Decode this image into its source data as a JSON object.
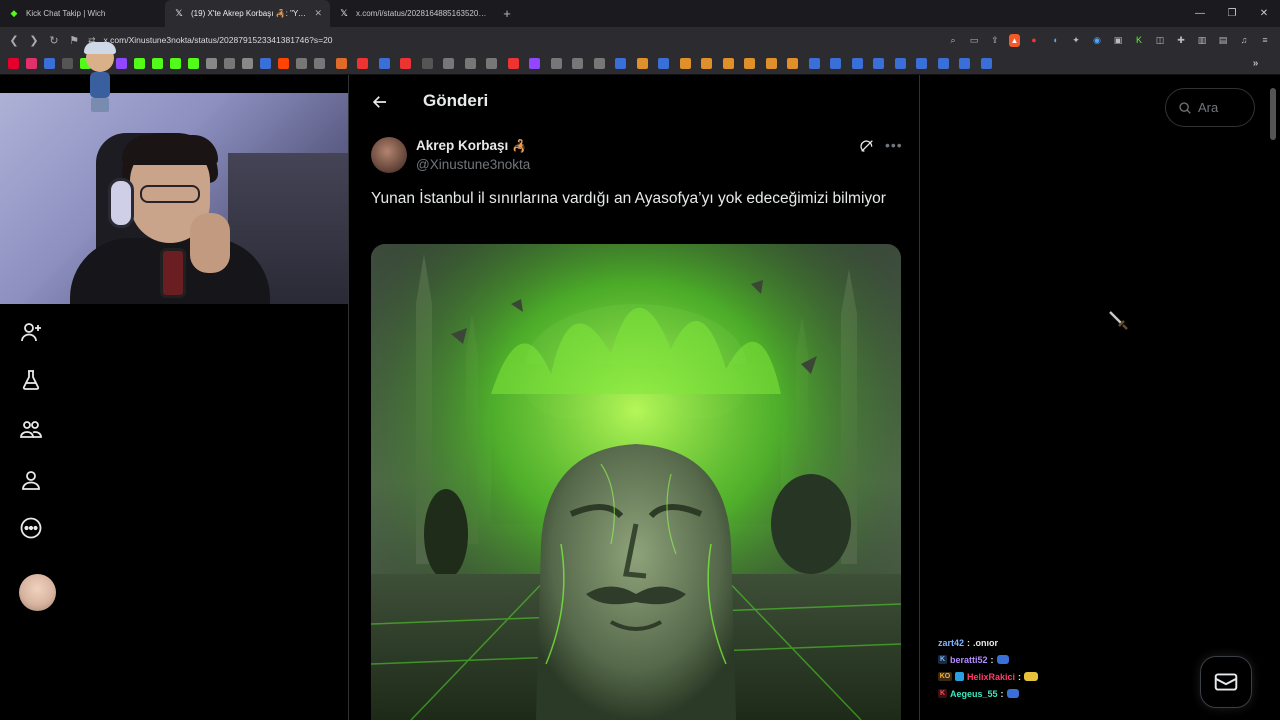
{
  "browser": {
    "tabs": [
      {
        "title": "Kick Chat Takip | Wich",
        "icon": "kick-icon"
      },
      {
        "title": "(19) X'te Akrep Korbaşı 🦂: \"Yuna",
        "icon": "x-logo-icon",
        "active": true
      },
      {
        "title": "x.com/i/status/2028164885163520130",
        "icon": "x-logo-icon"
      }
    ],
    "new_tab_label": "+",
    "url": "x.com/Xinustune3nokta/status/2028791523341381746?s=20"
  },
  "page": {
    "title": "Gönderi"
  },
  "tweet": {
    "author_name": "Akrep Korbaşı",
    "author_emoji": "🦂",
    "author_handle": "@Xinustune3nokta",
    "text": "Yunan İstanbul il sınırlarına vardığı an Ayasofya’yı yok edeceğimizi bilmiyor",
    "image_description": "Green flaming stone balbal statue in front of a mosque"
  },
  "search": {
    "placeholder": "Ara"
  },
  "left_nav": [
    {
      "name": "follow-icon"
    },
    {
      "name": "grok-flask-icon"
    },
    {
      "name": "communities-icon"
    },
    {
      "name": "profile-icon"
    },
    {
      "name": "more-circle-icon"
    }
  ],
  "chat": [
    {
      "user": "zart42",
      "user_color": "#7fb7ff",
      "separator": ":",
      "message": ".onıor",
      "badge": ""
    },
    {
      "user": "beratti52",
      "user_color": "#b48cff",
      "separator": ":",
      "message": "",
      "badge": "K"
    },
    {
      "user": "HelixRakici",
      "user_color": "#ff3d6e",
      "separator": ":",
      "message": "",
      "badge": "KO"
    },
    {
      "user": "Aegeus_55",
      "user_color": "#3ce6c0",
      "separator": ":",
      "message": "",
      "badge": "K"
    }
  ],
  "colors": {
    "background": "#000000",
    "text_primary": "#e7e9ea",
    "text_secondary": "#71767b",
    "border": "#2f3336",
    "browser_chrome": "#2b2b30",
    "kick_green": "#53fc18"
  }
}
